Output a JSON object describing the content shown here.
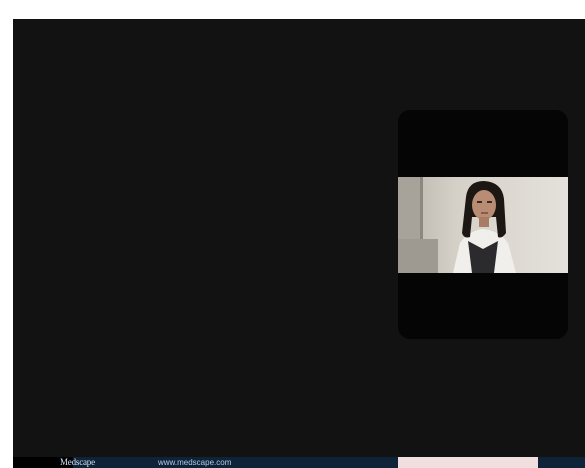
{
  "banner": {
    "brand": "Medscape",
    "website": "www.medscape.com"
  },
  "colors": {
    "stage_background": "#121212",
    "self_view_background": "#050505",
    "banner_background": "#0e2238",
    "banner_right_panel": "#f1dede"
  }
}
